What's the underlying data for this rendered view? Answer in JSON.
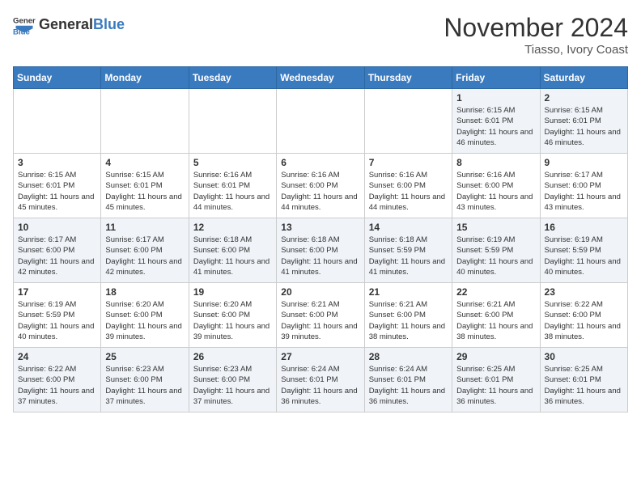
{
  "header": {
    "logo_general": "General",
    "logo_blue": "Blue",
    "month_title": "November 2024",
    "location": "Tiasso, Ivory Coast"
  },
  "weekdays": [
    "Sunday",
    "Monday",
    "Tuesday",
    "Wednesday",
    "Thursday",
    "Friday",
    "Saturday"
  ],
  "weeks": [
    [
      {
        "day": "",
        "info": ""
      },
      {
        "day": "",
        "info": ""
      },
      {
        "day": "",
        "info": ""
      },
      {
        "day": "",
        "info": ""
      },
      {
        "day": "",
        "info": ""
      },
      {
        "day": "1",
        "info": "Sunrise: 6:15 AM\nSunset: 6:01 PM\nDaylight: 11 hours and 46 minutes."
      },
      {
        "day": "2",
        "info": "Sunrise: 6:15 AM\nSunset: 6:01 PM\nDaylight: 11 hours and 46 minutes."
      }
    ],
    [
      {
        "day": "3",
        "info": "Sunrise: 6:15 AM\nSunset: 6:01 PM\nDaylight: 11 hours and 45 minutes."
      },
      {
        "day": "4",
        "info": "Sunrise: 6:15 AM\nSunset: 6:01 PM\nDaylight: 11 hours and 45 minutes."
      },
      {
        "day": "5",
        "info": "Sunrise: 6:16 AM\nSunset: 6:01 PM\nDaylight: 11 hours and 44 minutes."
      },
      {
        "day": "6",
        "info": "Sunrise: 6:16 AM\nSunset: 6:00 PM\nDaylight: 11 hours and 44 minutes."
      },
      {
        "day": "7",
        "info": "Sunrise: 6:16 AM\nSunset: 6:00 PM\nDaylight: 11 hours and 44 minutes."
      },
      {
        "day": "8",
        "info": "Sunrise: 6:16 AM\nSunset: 6:00 PM\nDaylight: 11 hours and 43 minutes."
      },
      {
        "day": "9",
        "info": "Sunrise: 6:17 AM\nSunset: 6:00 PM\nDaylight: 11 hours and 43 minutes."
      }
    ],
    [
      {
        "day": "10",
        "info": "Sunrise: 6:17 AM\nSunset: 6:00 PM\nDaylight: 11 hours and 42 minutes."
      },
      {
        "day": "11",
        "info": "Sunrise: 6:17 AM\nSunset: 6:00 PM\nDaylight: 11 hours and 42 minutes."
      },
      {
        "day": "12",
        "info": "Sunrise: 6:18 AM\nSunset: 6:00 PM\nDaylight: 11 hours and 41 minutes."
      },
      {
        "day": "13",
        "info": "Sunrise: 6:18 AM\nSunset: 6:00 PM\nDaylight: 11 hours and 41 minutes."
      },
      {
        "day": "14",
        "info": "Sunrise: 6:18 AM\nSunset: 5:59 PM\nDaylight: 11 hours and 41 minutes."
      },
      {
        "day": "15",
        "info": "Sunrise: 6:19 AM\nSunset: 5:59 PM\nDaylight: 11 hours and 40 minutes."
      },
      {
        "day": "16",
        "info": "Sunrise: 6:19 AM\nSunset: 5:59 PM\nDaylight: 11 hours and 40 minutes."
      }
    ],
    [
      {
        "day": "17",
        "info": "Sunrise: 6:19 AM\nSunset: 5:59 PM\nDaylight: 11 hours and 40 minutes."
      },
      {
        "day": "18",
        "info": "Sunrise: 6:20 AM\nSunset: 6:00 PM\nDaylight: 11 hours and 39 minutes."
      },
      {
        "day": "19",
        "info": "Sunrise: 6:20 AM\nSunset: 6:00 PM\nDaylight: 11 hours and 39 minutes."
      },
      {
        "day": "20",
        "info": "Sunrise: 6:21 AM\nSunset: 6:00 PM\nDaylight: 11 hours and 39 minutes."
      },
      {
        "day": "21",
        "info": "Sunrise: 6:21 AM\nSunset: 6:00 PM\nDaylight: 11 hours and 38 minutes."
      },
      {
        "day": "22",
        "info": "Sunrise: 6:21 AM\nSunset: 6:00 PM\nDaylight: 11 hours and 38 minutes."
      },
      {
        "day": "23",
        "info": "Sunrise: 6:22 AM\nSunset: 6:00 PM\nDaylight: 11 hours and 38 minutes."
      }
    ],
    [
      {
        "day": "24",
        "info": "Sunrise: 6:22 AM\nSunset: 6:00 PM\nDaylight: 11 hours and 37 minutes."
      },
      {
        "day": "25",
        "info": "Sunrise: 6:23 AM\nSunset: 6:00 PM\nDaylight: 11 hours and 37 minutes."
      },
      {
        "day": "26",
        "info": "Sunrise: 6:23 AM\nSunset: 6:00 PM\nDaylight: 11 hours and 37 minutes."
      },
      {
        "day": "27",
        "info": "Sunrise: 6:24 AM\nSunset: 6:01 PM\nDaylight: 11 hours and 36 minutes."
      },
      {
        "day": "28",
        "info": "Sunrise: 6:24 AM\nSunset: 6:01 PM\nDaylight: 11 hours and 36 minutes."
      },
      {
        "day": "29",
        "info": "Sunrise: 6:25 AM\nSunset: 6:01 PM\nDaylight: 11 hours and 36 minutes."
      },
      {
        "day": "30",
        "info": "Sunrise: 6:25 AM\nSunset: 6:01 PM\nDaylight: 11 hours and 36 minutes."
      }
    ]
  ]
}
